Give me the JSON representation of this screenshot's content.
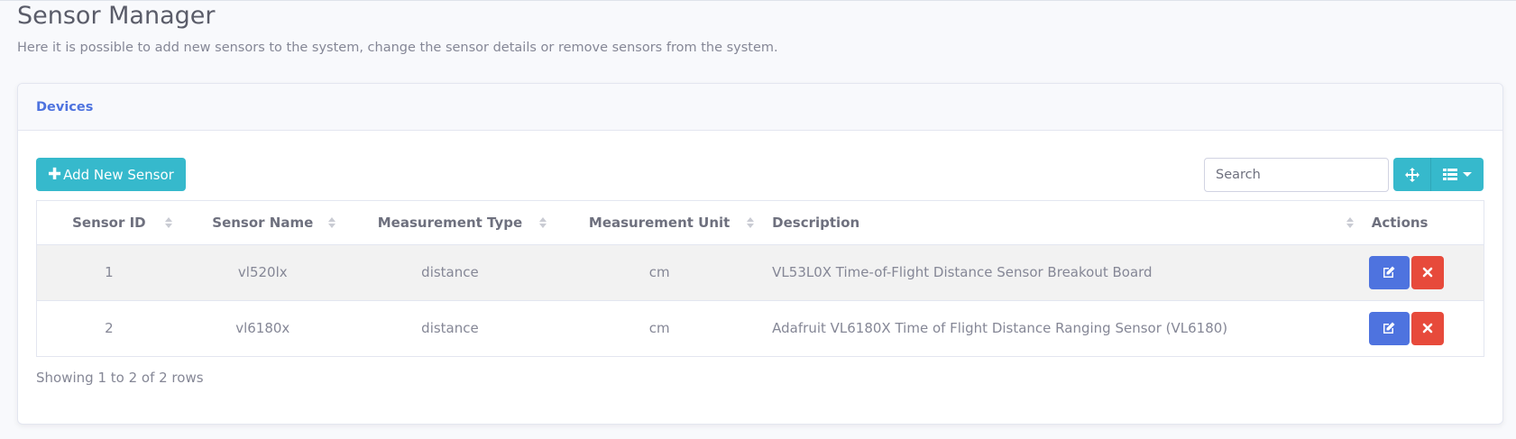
{
  "page": {
    "title": "Sensor Manager",
    "description": "Here it is possible to add new sensors to the system, change the sensor details or remove sensors from the system."
  },
  "card": {
    "header": "Devices"
  },
  "toolbar": {
    "add_label": "Add New Sensor",
    "search_placeholder": "Search"
  },
  "table": {
    "columns": [
      "Sensor ID",
      "Sensor Name",
      "Measurement Type",
      "Measurement Unit",
      "Description",
      "Actions"
    ],
    "rows": [
      {
        "id": "1",
        "name": "vl520lx",
        "type": "distance",
        "unit": "cm",
        "description": "VL53L0X Time-of-Flight Distance Sensor Breakout Board"
      },
      {
        "id": "2",
        "name": "vl6180x",
        "type": "distance",
        "unit": "cm",
        "description": "Adafruit VL6180X Time of Flight Distance Ranging Sensor (VL6180)"
      }
    ]
  },
  "pagination": {
    "summary": "Showing 1 to 2 of 2 rows"
  },
  "colors": {
    "primary": "#4e73df",
    "info": "#36b9cc",
    "danger": "#e74a3b"
  },
  "icons": {
    "add": "plus-icon",
    "move": "arrows-move-icon",
    "columns": "list-icon",
    "edit": "edit-icon",
    "delete": "close-icon"
  }
}
